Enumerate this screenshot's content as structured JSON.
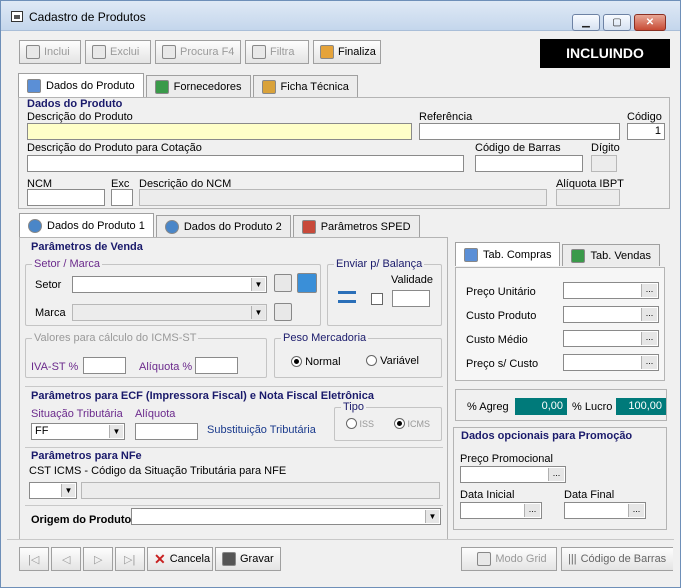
{
  "window": {
    "title": "Cadastro de Produtos",
    "min": "▁",
    "max": "▢",
    "close": "✕"
  },
  "toolbar": {
    "inclui": "Inclui",
    "exclui": "Exclui",
    "procura": "Procura F4",
    "filtra": "Filtra",
    "finaliza": "Finaliza"
  },
  "status": "INCLUINDO",
  "tabs": [
    "Dados do Produto",
    "Fornecedores",
    "Ficha Técnica"
  ],
  "dados_produto": {
    "section": "Dados do Produto",
    "descricao_label": "Descrição do Produto",
    "descricao": "",
    "referencia_label": "Referência",
    "referencia": "",
    "codigo_label": "Código",
    "codigo": "1",
    "desc_cotacao_label": "Descrição do Produto para Cotação",
    "desc_cotacao": "",
    "codbarras_label": "Código de Barras",
    "codbarras": "",
    "digito_label": "Dígito",
    "ncm_label": "NCM",
    "exc_label": "Exc",
    "desc_ncm_label": "Descrição do NCM",
    "aliquota_ibpt_label": "Alíquota IBPT"
  },
  "subtabs": [
    "Dados do Produto 1",
    "Dados do Produto 2",
    "Parâmetros SPED"
  ],
  "venda": {
    "section": "Parâmetros de Venda",
    "setor_marca": "Setor / Marca",
    "setor": "Setor",
    "marca": "Marca",
    "balanca": "Enviar p/ Balança",
    "validade": "Validade",
    "icms_st": "Valores para cálculo do ICMS-ST",
    "iva_st": "IVA-ST %",
    "aliquota_pct": "Alíquota %",
    "peso": "Peso Mercadoria",
    "normal": "Normal",
    "variavel": "Variável"
  },
  "ecf": {
    "section": "Parâmetros para ECF (Impressora Fiscal) e Nota Fiscal Eletrônica",
    "sit_trib": "Situação Tributária",
    "sit_trib_value": "FF",
    "aliquota": "Alíquota",
    "subst": "Substituição Tributária",
    "tipo": "Tipo",
    "iss": "ISS",
    "icms": "ICMS"
  },
  "nfe": {
    "section": "Parâmetros para NFe",
    "cst": "CST ICMS - Código da Situação Tributária para NFE",
    "origem": "Origem do Produto"
  },
  "right": {
    "tabs": [
      "Tab. Compras",
      "Tab. Vendas"
    ],
    "fields": [
      "Preço Unitário",
      "Custo Produto",
      "Custo Médio",
      "Preço s/ Custo"
    ],
    "agreg_label": "% Agreg",
    "agreg": "0,00",
    "lucro_label": "% Lucro",
    "lucro": "100,00",
    "promo": "Dados opcionais para Promoção",
    "preco_promo": "Preço Promocional",
    "data_inicial": "Data Inicial",
    "data_final": "Data Final"
  },
  "bottom": {
    "cancela": "Cancela",
    "gravar": "Gravar",
    "modo_grid": "Modo Grid",
    "cod_barras": "Código de Barras"
  }
}
